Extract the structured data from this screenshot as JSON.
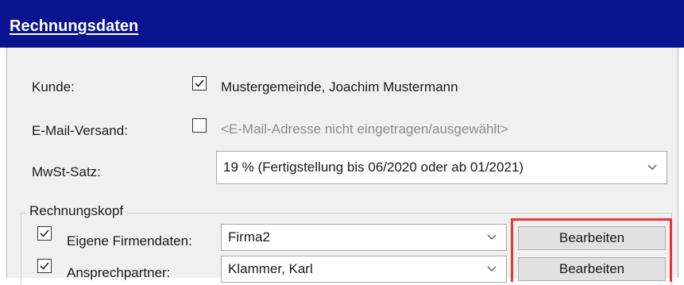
{
  "header": {
    "title": "Rechnungsdaten"
  },
  "fields": {
    "kunde": {
      "label": "Kunde:",
      "checked": true,
      "value": "Mustergemeinde, Joachim Mustermann"
    },
    "email": {
      "label": "E-Mail-Versand:",
      "checked": false,
      "value": "<E-Mail-Adresse nicht eingetragen/ausgewählt>"
    },
    "mwst": {
      "label": "MwSt-Satz:",
      "selected": "19 % (Fertigstellung bis 06/2020 oder ab 01/2021)"
    }
  },
  "rechnungskopf": {
    "title": "Rechnungskopf",
    "rows": [
      {
        "label": "Eigene Firmendaten:",
        "checked": true,
        "selected": "Firma2",
        "button": "Bearbeiten"
      },
      {
        "label": "Ansprechpartner:",
        "checked": true,
        "selected": "Klammer, Karl",
        "button": "Bearbeiten"
      }
    ]
  },
  "colors": {
    "header_bg": "#0a1390",
    "panel_bg": "#f0f0f0",
    "highlight": "#e8333a"
  }
}
